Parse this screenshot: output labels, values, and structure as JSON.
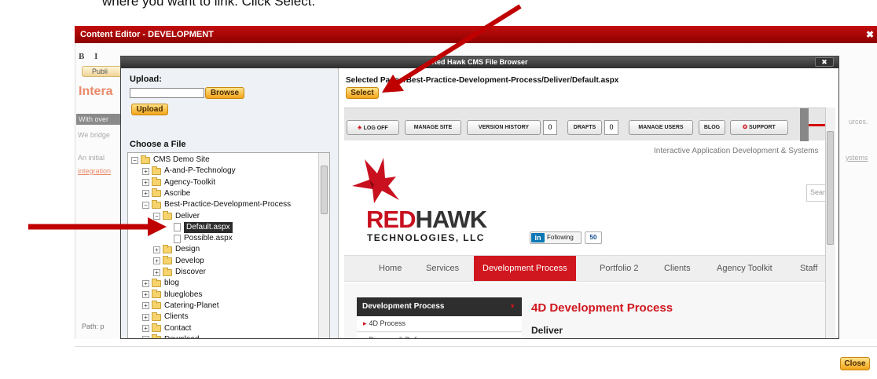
{
  "instruction": "where you want to link. Click Select.",
  "content_editor": {
    "title": "Content Editor - DEVELOPMENT",
    "close_icon": "✖",
    "toolbar_text": "B I",
    "tab_label": "Publi",
    "heading": "Intera",
    "gray_text": "With over",
    "line1": "We bridge",
    "line2": "An initial",
    "link_text": "integration",
    "path_label": "Path: p",
    "right_text_1": "urces.",
    "right_text_2": "ystems",
    "close_button": "Close"
  },
  "file_browser": {
    "title": "Red Hawk CMS File Browser",
    "close_label": "✖",
    "upload_label": "Upload:",
    "upload_value": "",
    "browse_button": "Browse",
    "upload_button": "Upload",
    "choose_label": "Choose a File",
    "selected_path": "Selected Page: /Best-Practice-Development-Process/Deliver/Default.aspx",
    "select_button": "Select",
    "tree": [
      {
        "label": "CMS Demo Site",
        "level": 0,
        "expander": "−",
        "type": "folder"
      },
      {
        "label": "A-and-P-Technology",
        "level": 1,
        "expander": "+",
        "type": "folder"
      },
      {
        "label": "Agency-Toolkit",
        "level": 1,
        "expander": "+",
        "type": "folder"
      },
      {
        "label": "Ascribe",
        "level": 1,
        "expander": "+",
        "type": "folder"
      },
      {
        "label": "Best-Practice-Development-Process",
        "level": 1,
        "expander": "−",
        "type": "folder"
      },
      {
        "label": "Deliver",
        "level": 2,
        "expander": "−",
        "type": "folder"
      },
      {
        "label": "Default.aspx",
        "level": 3,
        "expander": "",
        "type": "file",
        "selected": true
      },
      {
        "label": "Possible.aspx",
        "level": 3,
        "expander": "",
        "type": "file"
      },
      {
        "label": "Design",
        "level": 2,
        "expander": "+",
        "type": "folder"
      },
      {
        "label": "Develop",
        "level": 2,
        "expander": "+",
        "type": "folder"
      },
      {
        "label": "Discover",
        "level": 2,
        "expander": "+",
        "type": "folder"
      },
      {
        "label": "blog",
        "level": 1,
        "expander": "+",
        "type": "folder"
      },
      {
        "label": "blueglobes",
        "level": 1,
        "expander": "+",
        "type": "folder"
      },
      {
        "label": "Catering-Planet",
        "level": 1,
        "expander": "+",
        "type": "folder"
      },
      {
        "label": "Clients",
        "level": 1,
        "expander": "+",
        "type": "folder"
      },
      {
        "label": "Contact",
        "level": 1,
        "expander": "+",
        "type": "folder"
      },
      {
        "label": "Download",
        "level": 1,
        "expander": "+",
        "type": "folder"
      }
    ]
  },
  "preview": {
    "toolbar": {
      "log_off": "LOG OFF",
      "manage_site": "MANAGE SITE",
      "version_history": "VERSION HISTORY",
      "version_count": "0",
      "drafts": "DRAFTS",
      "drafts_count": "0",
      "manage_users": "MANAGE USERS",
      "blog": "BLOG",
      "support": "SUPPORT"
    },
    "tagline": "Interactive Application Development & Systems",
    "search_placeholder": "Search",
    "logo_red": "RED",
    "logo_dark": "HAWK",
    "logo_sub": "TECHNOLOGIES, LLC",
    "linkedin_in": "in",
    "linkedin_label": "Following",
    "linkedin_count": "50",
    "nav": [
      "Home",
      "Services",
      "Development Process",
      "Portfolio 2",
      "Clients",
      "Agency Toolkit",
      "Staff"
    ],
    "nav_active": "Development Process",
    "sidebar_heading": "Development Process",
    "sidebar_items": [
      "4D Process",
      "Discover & Define"
    ],
    "main_heading": "4D Development Process",
    "main_sub": "Deliver"
  },
  "colors": {
    "accent_red": "#c8101f",
    "title_bar_red": "#c30d0d",
    "button_yellow": "#f2a51a",
    "arrow_red": "#c00000"
  }
}
